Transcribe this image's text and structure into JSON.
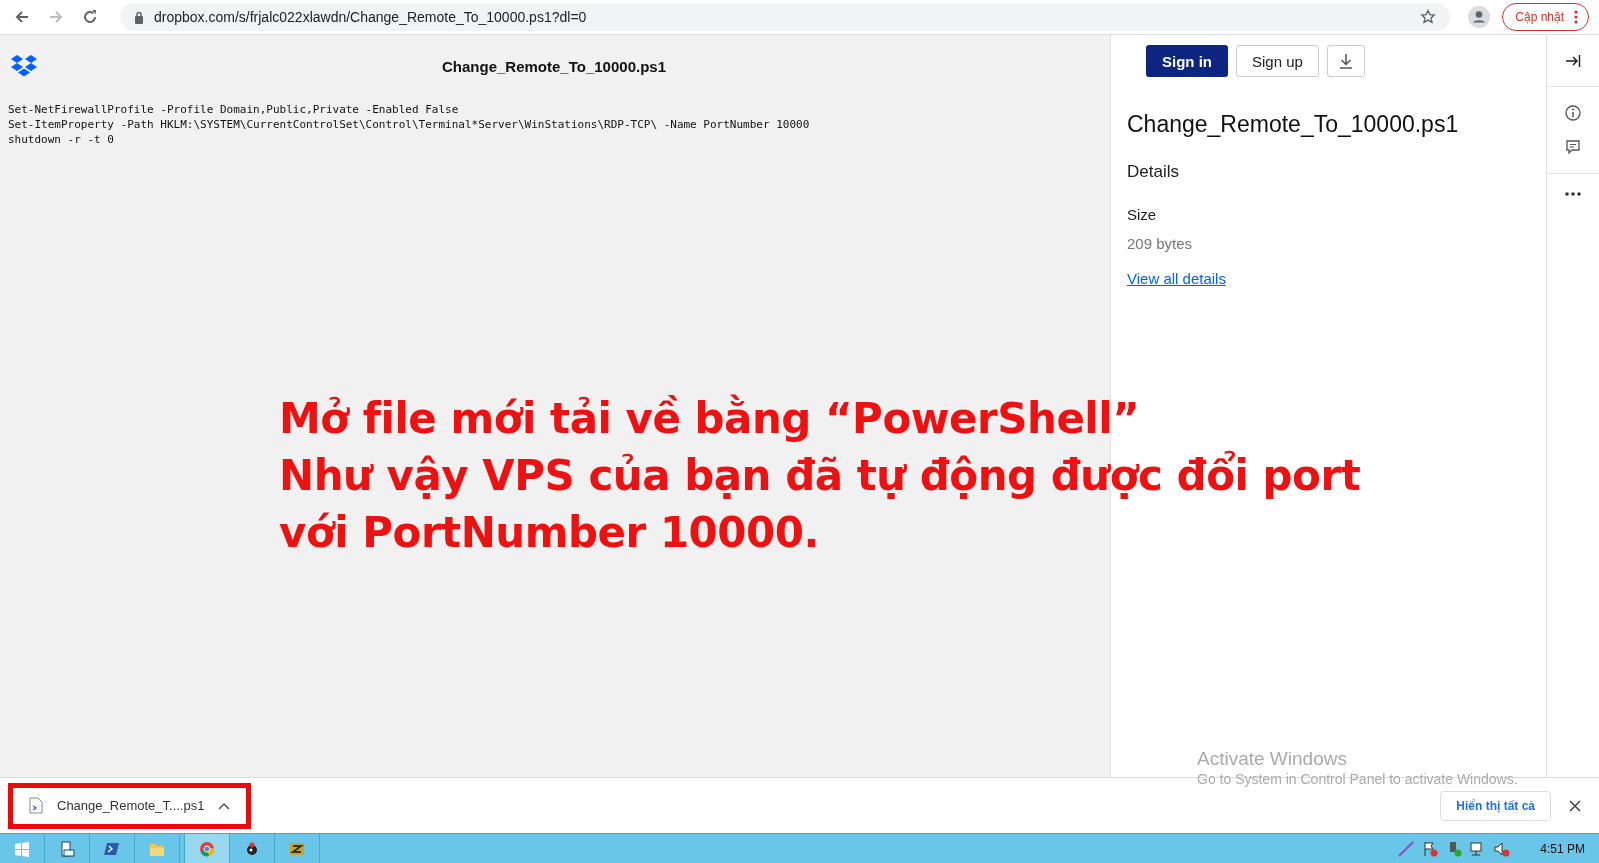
{
  "browser": {
    "url": "dropbox.com/s/frjalc022xlawdn/Change_Remote_To_10000.ps1?dl=0",
    "update_button": "Cập nhật"
  },
  "viewer": {
    "title": "Change_Remote_To_10000.ps1",
    "code_lines": [
      "Set-NetFirewallProfile -Profile Domain,Public,Private -Enabled False",
      "Set-ItemProperty -Path HKLM:\\SYSTEM\\CurrentControlSet\\Control\\Terminal*Server\\WinStations\\RDP-TCP\\ -Name PortNumber 10000",
      "shutdown -r -t 0"
    ]
  },
  "annotation": {
    "lines": [
      "Mở file mới tải về bằng “PowerShell”",
      "Như vậy VPS của bạn đã tự động được đổi port",
      "với PortNumber 10000."
    ]
  },
  "panel": {
    "sign_in": "Sign in",
    "sign_up": "Sign up",
    "file_name": "Change_Remote_To_10000.ps1",
    "details_heading": "Details",
    "size_label": "Size",
    "size_value": "209 bytes",
    "details_link": "View all details"
  },
  "activation_notice": {
    "title": "Activate Windows",
    "message": "Go to System in Control Panel to activate Windows."
  },
  "download_bar": {
    "items": [
      {
        "name": "Change_Remote_T....ps1",
        "highlighted": true
      }
    ],
    "show_all": "Hiển thị tất cả"
  },
  "taskbar": {
    "apps": [
      {
        "kind": "start",
        "active": false
      },
      {
        "kind": "server",
        "active": false
      },
      {
        "kind": "shell",
        "active": false
      },
      {
        "kind": "folder",
        "active": false
      },
      {
        "kind": "chrome",
        "active": true
      },
      {
        "kind": "bug",
        "active": false
      },
      {
        "kind": "zip",
        "active": false
      }
    ],
    "clock": "4:51 PM"
  }
}
